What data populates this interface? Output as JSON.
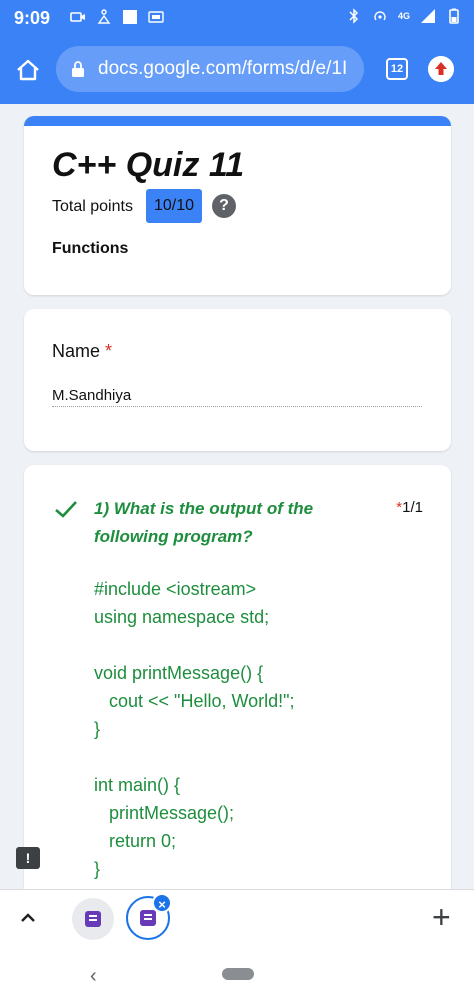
{
  "status": {
    "time": "9:09",
    "network": "4G"
  },
  "browser": {
    "url": "docs.google.com/forms/d/e/1I",
    "tab_count": "12"
  },
  "quiz": {
    "title": "C++ Quiz 11",
    "total_points_label": "Total points",
    "points": "10/10",
    "help": "?",
    "section": "Functions"
  },
  "name_field": {
    "label": "Name",
    "required_mark": "*",
    "value": "M.Sandhiya"
  },
  "question1": {
    "text": "1)  What is the output of the following program?",
    "required_mark": "*",
    "score": "1/1",
    "code": "#include <iostream>\nusing namespace std;\n\nvoid printMessage() {\n   cout << \"Hello, World!\";\n}\n\nint main() {\n   printMessage();\n   return 0;\n}"
  },
  "colors": {
    "accent": "#3b82f6",
    "correct": "#1e8e3e",
    "required": "#d93025"
  }
}
